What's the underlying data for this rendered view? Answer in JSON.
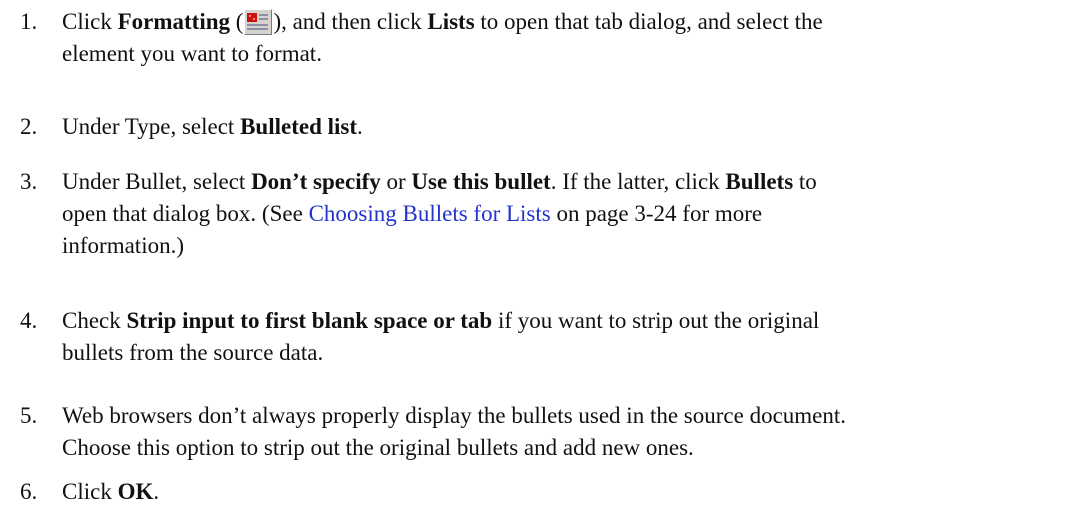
{
  "steps": [
    {
      "number": "1.",
      "t1": "Click ",
      "b1": "Formatting",
      "t2": " (",
      "icon": "formatting-icon",
      "t3": "), and then click ",
      "b2": "Lists",
      "t4": " to open that tab dialog, and select the",
      "line2": "element you want to format."
    },
    {
      "number": "2.",
      "t1": "Under Type, select ",
      "b1": "Bulleted list",
      "t2": "."
    },
    {
      "number": "3.",
      "t1": "Under Bullet, select ",
      "b1": "Don’t specify",
      "t2": " or ",
      "b2": "Use this bullet",
      "t3": ". If the latter, click ",
      "b3": "Bullets",
      "t4": " to",
      "line2a": "open that dialog box. (See ",
      "link": "Choosing Bullets for Lists",
      "line2b": " on page 3-24 for more",
      "line3": "information.)"
    },
    {
      "number": "4.",
      "t1": "Check ",
      "b1": "Strip input to first blank space or tab",
      "t2": " if you want to strip out the original",
      "line2": "bullets from the source data."
    },
    {
      "number": "5.",
      "line1": "Web browsers don’t always properly display the bullets used in the source document.",
      "line2": "Choose this option to strip out the original bullets and add new ones."
    },
    {
      "number": "6.",
      "t1": "Click ",
      "b1": "OK",
      "t2": "."
    }
  ],
  "colors": {
    "link": "#2233cc",
    "text": "#111111"
  }
}
